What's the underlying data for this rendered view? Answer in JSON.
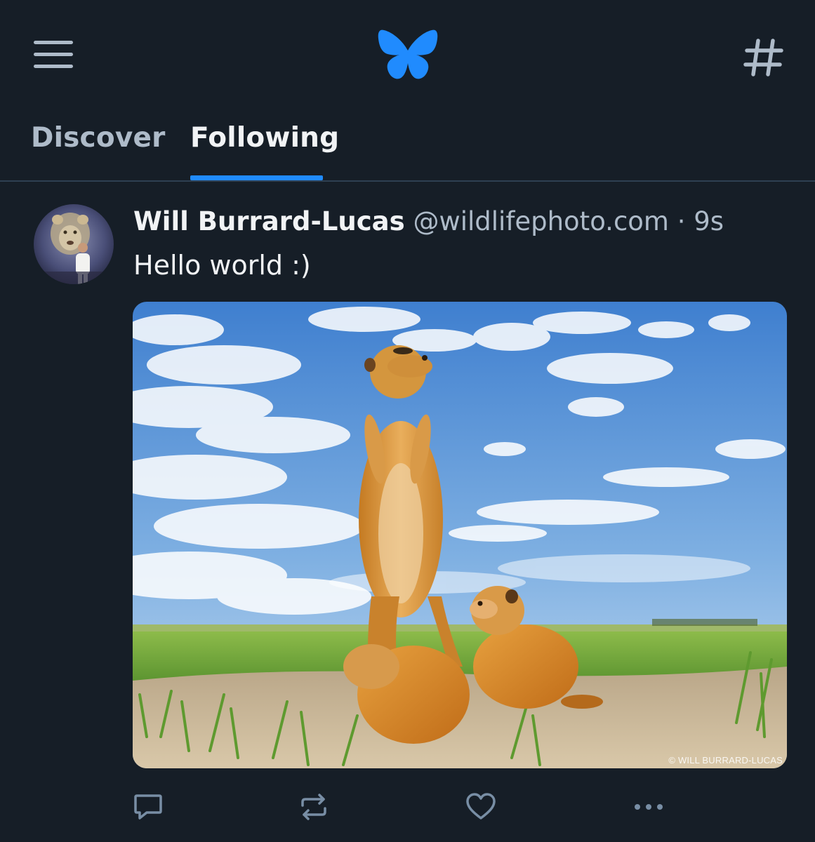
{
  "header": {
    "menu_icon": "hamburger-menu-icon",
    "logo_icon": "bluesky-butterfly-icon",
    "feeds_icon": "hashtag-icon",
    "brand_color": "#208bfe"
  },
  "tabs": [
    {
      "label": "Discover",
      "active": false
    },
    {
      "label": "Following",
      "active": true
    }
  ],
  "post": {
    "author_name": "Will Burrard-Lucas",
    "handle": "@wildlifephoto.com",
    "separator": "·",
    "timestamp": "9s",
    "text": "Hello world :)",
    "image_watermark": "© WILL BURRARD-LUCAS",
    "actions": [
      "reply-icon",
      "repost-icon",
      "like-icon",
      "more-icon"
    ]
  },
  "colors": {
    "background": "#161e27",
    "text_primary": "#f1f3f5",
    "text_secondary": "#aebbc9",
    "divider": "#2e4052",
    "accent": "#208bfe"
  }
}
